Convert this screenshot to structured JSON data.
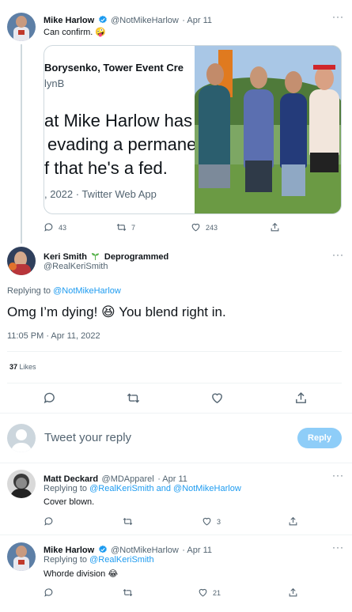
{
  "tweet1": {
    "name": "Mike Harlow",
    "handle": "@NotMikeHarlow",
    "date": "· Apr 11",
    "text": "Can confirm.",
    "emoji": "🤪",
    "quote": {
      "line1": "Borysenko, Tower Event Cre",
      "line2": "lynB",
      "big1": "at Mike Harlow has",
      "big2": "evading a permane",
      "big3": "f that he's a fed.",
      "meta": ", 2022 · Twitter Web App"
    },
    "replies": "43",
    "retweets": "7",
    "likes": "243"
  },
  "main": {
    "name": "Keri Smith",
    "name_suffix": "Deprogrammed",
    "handle": "@RealKeriSmith",
    "replying_prefix": "Replying to ",
    "replying_to": "@NotMikeHarlow",
    "text": "Omg I’m dying!",
    "emoji": "😆",
    "text2": "You blend right in.",
    "timestamp": "11:05 PM · Apr 11, 2022",
    "likes_count": "37",
    "likes_label": "Likes"
  },
  "compose": {
    "placeholder": "Tweet your reply",
    "button": "Reply"
  },
  "reply1": {
    "name": "Matt Deckard",
    "handle": "@MDApparel",
    "date": "· Apr 11",
    "replying_prefix": "Replying to ",
    "replying_to": "@RealKeriSmith and @NotMikeHarlow",
    "text": "Cover blown.",
    "likes": "3"
  },
  "reply2": {
    "name": "Mike Harlow",
    "handle": "@NotMikeHarlow",
    "date": "· Apr 11",
    "replying_prefix": "Replying to ",
    "replying_to": "@RealKeriSmith",
    "text": "Whorde division",
    "emoji": "😂",
    "likes": "21"
  },
  "icons": {
    "reply": "reply-icon",
    "retweet": "retweet-icon",
    "like": "heart-icon",
    "share": "share-icon",
    "more": "more-icon",
    "verified": "verified-badge-icon",
    "sprout": "sprout-icon"
  },
  "colors": {
    "accent": "#1d9bf0",
    "reply_button": "#8ecdf8",
    "muted": "#536471",
    "divider": "#eff3f4"
  }
}
